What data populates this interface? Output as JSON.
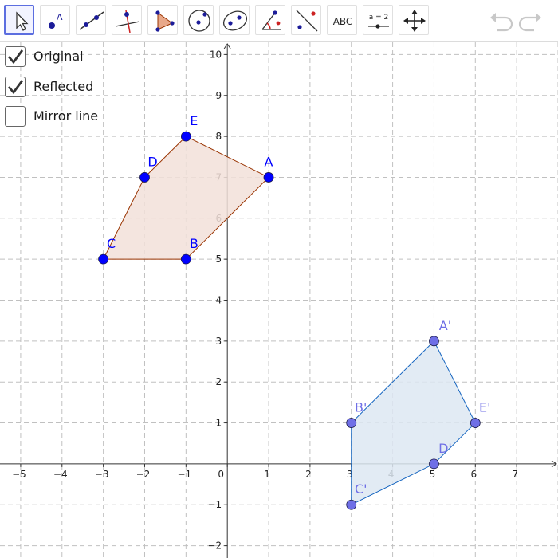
{
  "toolbar": {
    "tools": [
      {
        "name": "move-tool",
        "label": ""
      },
      {
        "name": "point-tool",
        "label": "A"
      },
      {
        "name": "line-tool",
        "label": ""
      },
      {
        "name": "perpendicular-line-tool",
        "label": ""
      },
      {
        "name": "polygon-tool",
        "label": ""
      },
      {
        "name": "circle-center-point-tool",
        "label": ""
      },
      {
        "name": "ellipse-tool",
        "label": ""
      },
      {
        "name": "angle-tool",
        "label": ""
      },
      {
        "name": "reflect-about-line-tool",
        "label": ""
      },
      {
        "name": "text-tool",
        "label": "ABC"
      },
      {
        "name": "slider-tool",
        "label": "a = 2"
      },
      {
        "name": "move-graphics-view-tool",
        "label": ""
      }
    ],
    "selected": "move-tool",
    "undo_icon": "undo-icon",
    "redo_icon": "redo-icon"
  },
  "checkboxes": [
    {
      "label": "Original",
      "checked": true
    },
    {
      "label": "Reflected",
      "checked": true
    },
    {
      "label": "Mirror line",
      "checked": false
    }
  ],
  "chart_data": {
    "type": "scatter",
    "xlim": [
      -5.5,
      8
    ],
    "ylim": [
      -2.3,
      10.3
    ],
    "x_ticks": [
      "−5",
      "−4",
      "−3",
      "−2",
      "−1",
      "0",
      "1",
      "2",
      "3",
      "4",
      "5",
      "6",
      "7"
    ],
    "y_ticks": [
      "−2",
      "−1",
      "1",
      "2",
      "3",
      "4",
      "5",
      "6",
      "7",
      "8",
      "9",
      "10"
    ],
    "grid": true,
    "polygons": [
      {
        "name": "Original",
        "color": "#993300",
        "fill": "#f2e1d9",
        "point_color": "#0000ff",
        "label_color": "#0000ff",
        "points": [
          {
            "label": "A",
            "x": 1,
            "y": 7
          },
          {
            "label": "B",
            "x": -1,
            "y": 5
          },
          {
            "label": "C",
            "x": -3,
            "y": 5
          },
          {
            "label": "D",
            "x": -2,
            "y": 7
          },
          {
            "label": "E",
            "x": -1,
            "y": 8
          }
        ]
      },
      {
        "name": "Reflected",
        "color": "#1565c0",
        "fill": "#dde8f2",
        "point_color": "#6f6fe6",
        "label_color": "#6f6fe6",
        "points": [
          {
            "label": "A'",
            "x": 5,
            "y": 3
          },
          {
            "label": "B'",
            "x": 3,
            "y": 1
          },
          {
            "label": "C'",
            "x": 3,
            "y": -1
          },
          {
            "label": "D'",
            "x": 5,
            "y": 0
          },
          {
            "label": "E'",
            "x": 6,
            "y": 1
          }
        ]
      }
    ]
  }
}
